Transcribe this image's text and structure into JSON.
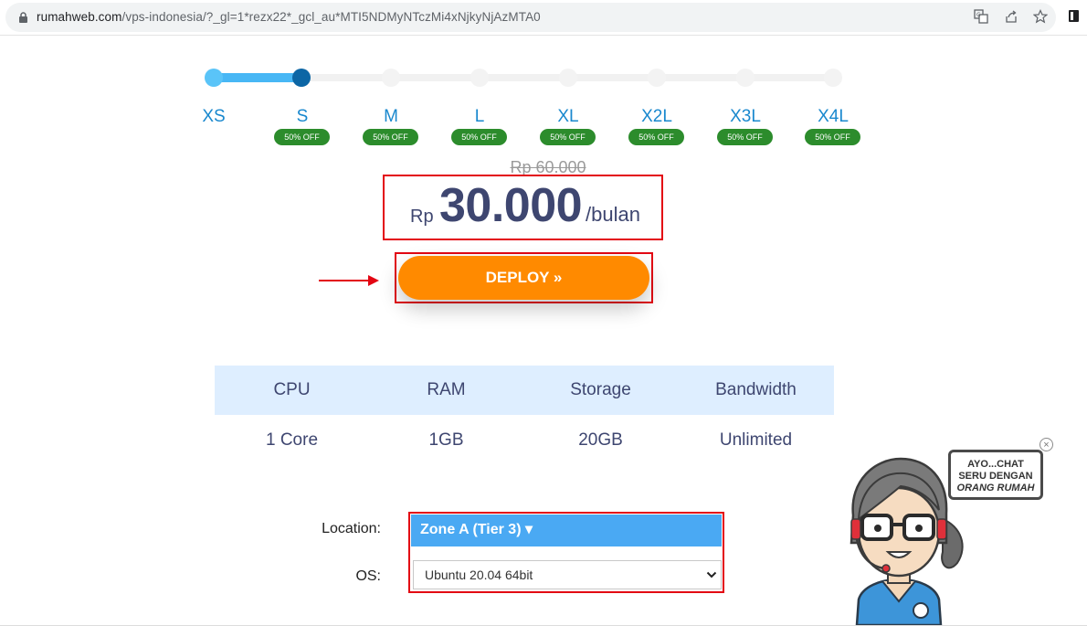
{
  "browser": {
    "url_domain": "rumahweb.com",
    "url_path": "/vps-indonesia/?_gl=1*rezx22*_gcl_au*MTI5NDMyNTczMi4xNjkyNjAzMTA0"
  },
  "plans": {
    "tiers": [
      {
        "label": "XS",
        "badge": ""
      },
      {
        "label": "S",
        "badge": "50% OFF"
      },
      {
        "label": "M",
        "badge": "50% OFF"
      },
      {
        "label": "L",
        "badge": "50% OFF"
      },
      {
        "label": "XL",
        "badge": "50% OFF"
      },
      {
        "label": "X2L",
        "badge": "50% OFF"
      },
      {
        "label": "X3L",
        "badge": "50% OFF"
      },
      {
        "label": "X4L",
        "badge": "50% OFF"
      }
    ],
    "selected": "S"
  },
  "price": {
    "old": "Rp 60.000",
    "currency": "Rp",
    "amount": "30.000",
    "period": "/bulan"
  },
  "deploy": {
    "label": "DEPLOY »"
  },
  "specs": {
    "headers": [
      "CPU",
      "RAM",
      "Storage",
      "Bandwidth"
    ],
    "values": [
      "1 Core",
      "1GB",
      "20GB",
      "Unlimited"
    ]
  },
  "config": {
    "location_label": "Location:",
    "location_value": "Zone A (Tier 3)",
    "location_caret": "▾",
    "os_label": "OS:",
    "os_value": "Ubuntu 20.04 64bit"
  },
  "chat": {
    "line1": "AYO...CHAT",
    "line2": "SERU DENGAN",
    "line3": "ORANG RUMAH",
    "close": "×"
  },
  "colors": {
    "accent_blue": "#1988ce",
    "deploy_orange": "#ff8a00",
    "badge_green": "#2c8c2c",
    "highlight_red": "#e30613",
    "zone_blue": "#4aa9f3"
  }
}
